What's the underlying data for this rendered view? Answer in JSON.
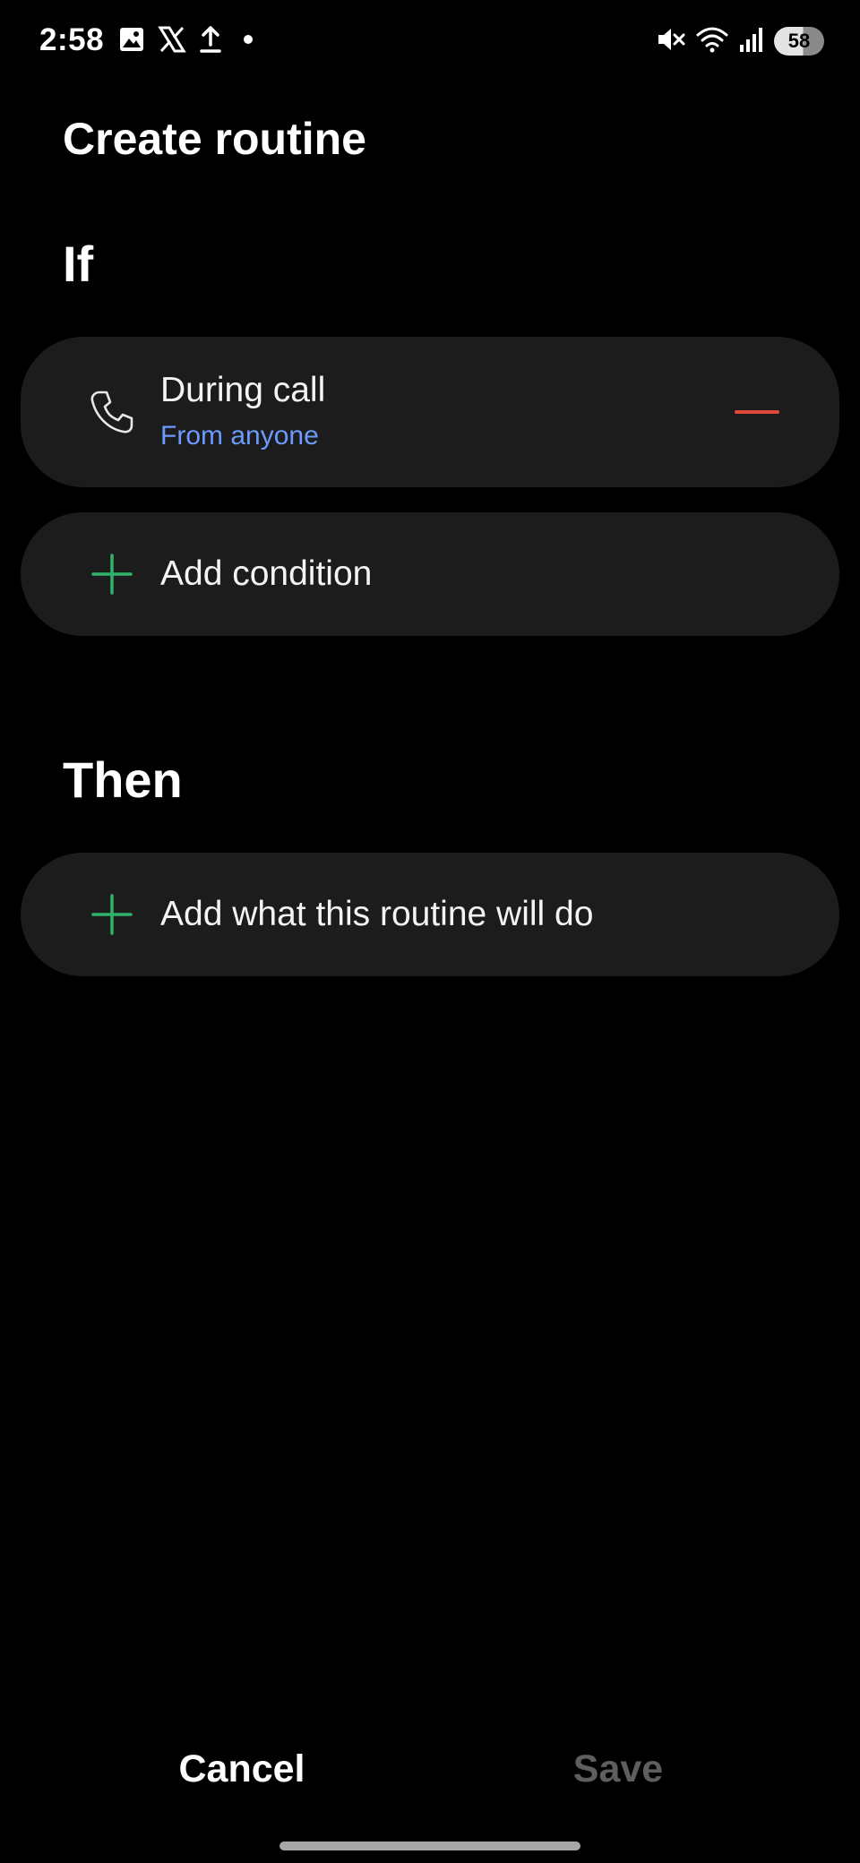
{
  "status_bar": {
    "time": "2:58",
    "left_icons": [
      "gallery-icon",
      "x-logo-icon",
      "upload-icon",
      "dot-icon"
    ],
    "right_icons": [
      "mute-icon",
      "wifi-icon",
      "signal-icon"
    ],
    "battery": "58"
  },
  "page": {
    "title": "Create routine"
  },
  "if_section": {
    "heading": "If",
    "condition": {
      "icon": "phone-icon",
      "title": "During call",
      "subtitle": "From anyone"
    },
    "add_condition": {
      "icon": "plus-icon",
      "label": "Add condition"
    }
  },
  "then_section": {
    "heading": "Then",
    "add_action": {
      "icon": "plus-icon",
      "label": "Add what this routine will do"
    }
  },
  "bottom_bar": {
    "cancel_label": "Cancel",
    "save_label": "Save"
  },
  "colors": {
    "background": "#000000",
    "card": "#1c1c1c",
    "accent_blue": "#6b9bff",
    "add_green": "#2fb36b",
    "remove_red": "#e0483a",
    "disabled_text": "#5e5e5e"
  }
}
